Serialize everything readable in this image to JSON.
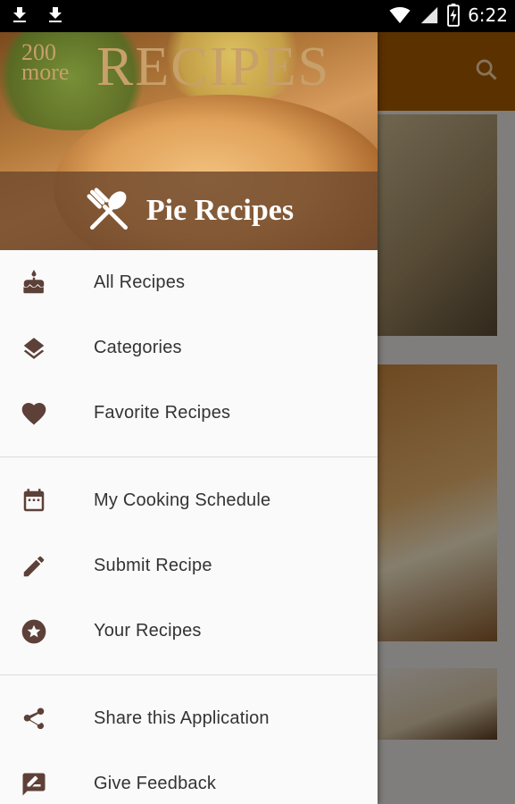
{
  "status_bar": {
    "time": "6:22"
  },
  "header": {
    "logo_small": "200 more",
    "logo_big": "RECIPES",
    "title": "Pie Recipes"
  },
  "menu": {
    "group1": [
      {
        "label": "All Recipes",
        "icon": "cake-icon"
      },
      {
        "label": "Categories",
        "icon": "layers-icon"
      },
      {
        "label": "Favorite Recipes",
        "icon": "heart-icon"
      }
    ],
    "group2": [
      {
        "label": "My Cooking Schedule",
        "icon": "calendar-icon"
      },
      {
        "label": "Submit Recipe",
        "icon": "pencil-icon"
      },
      {
        "label": "Your Recipes",
        "icon": "star-icon"
      }
    ],
    "group3": [
      {
        "label": "Share this Application",
        "icon": "share-icon"
      },
      {
        "label": "Give Feedback",
        "icon": "feedback-icon"
      }
    ]
  },
  "colors": {
    "brown": "#5d4037",
    "app_bar": "#a85a00"
  }
}
